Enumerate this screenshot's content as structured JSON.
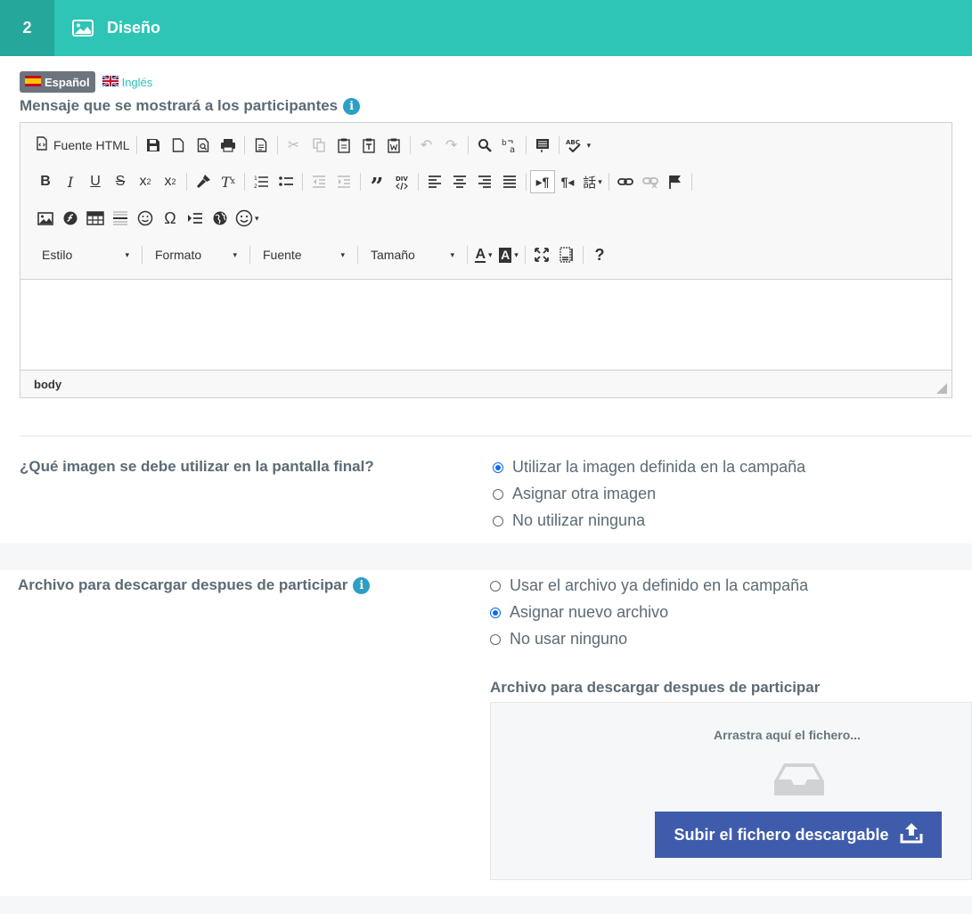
{
  "header": {
    "step": "2",
    "title": "Diseño",
    "icon": "image-icon"
  },
  "languages": [
    {
      "label": "Español",
      "active": true,
      "flag": "spain-flag-icon"
    },
    {
      "label": "Inglés",
      "active": false,
      "flag": "uk-flag-icon"
    }
  ],
  "message": {
    "label": "Mensaje que se mostrará a los participantes"
  },
  "editor": {
    "source_button": "Fuente HTML",
    "combos": {
      "style": "Estilo",
      "format": "Formato",
      "font": "Fuente",
      "size": "Tamaño"
    },
    "status_path": "body"
  },
  "image_question": {
    "label": "¿Qué imagen se debe utilizar en la pantalla final?",
    "options": [
      {
        "label": "Utilizar la imagen definida en la campaña",
        "checked": true
      },
      {
        "label": "Asignar otra imagen",
        "checked": false
      },
      {
        "label": "No utilizar ninguna",
        "checked": false
      }
    ]
  },
  "download_question": {
    "label": "Archivo para descargar despues de participar",
    "options": [
      {
        "label": "Usar el archivo ya definido en la campaña",
        "checked": false
      },
      {
        "label": "Asignar nuevo archivo",
        "checked": true
      },
      {
        "label": "No usar ninguno",
        "checked": false
      }
    ]
  },
  "upload": {
    "label": "Archivo para descargar despues de participar",
    "drop_text": "Arrastra aquí el fichero...",
    "button_label": "Subir el fichero descargable"
  },
  "colors": {
    "header": "#2ec4b6",
    "step": "#25a89b",
    "upload_button": "#3f5bab",
    "radio_checked": "#0a6cf0"
  }
}
